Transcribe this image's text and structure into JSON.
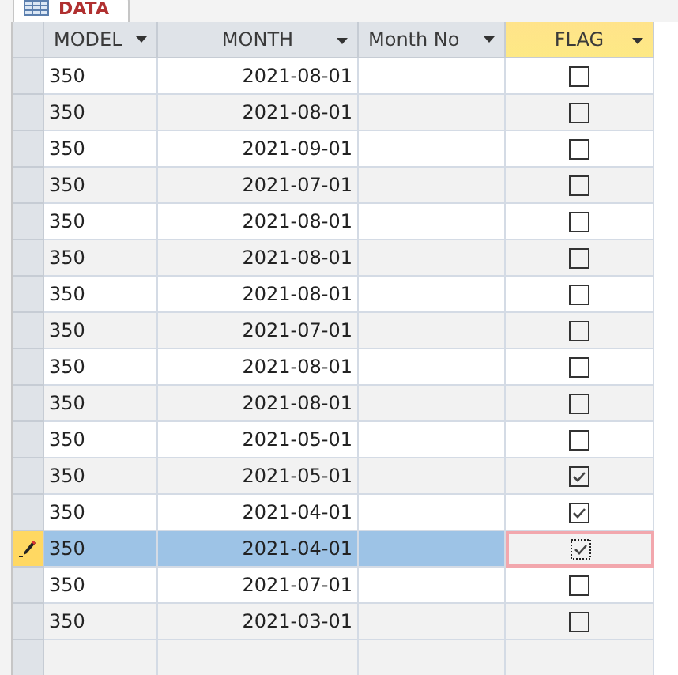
{
  "tab": {
    "label": "DATA"
  },
  "columns": [
    {
      "label": "MODEL",
      "selected": false
    },
    {
      "label": "MONTH",
      "selected": false
    },
    {
      "label": "Month No",
      "selected": false
    },
    {
      "label": "FLAG",
      "selected": true
    }
  ],
  "rows": [
    {
      "model": "350",
      "month": "2021-08-01",
      "checked": false,
      "selected": false
    },
    {
      "model": "350",
      "month": "2021-08-01",
      "checked": false,
      "selected": false
    },
    {
      "model": "350",
      "month": "2021-09-01",
      "checked": false,
      "selected": false
    },
    {
      "model": "350",
      "month": "2021-07-01",
      "checked": false,
      "selected": false
    },
    {
      "model": "350",
      "month": "2021-08-01",
      "checked": false,
      "selected": false
    },
    {
      "model": "350",
      "month": "2021-08-01",
      "checked": false,
      "selected": false
    },
    {
      "model": "350",
      "month": "2021-08-01",
      "checked": false,
      "selected": false
    },
    {
      "model": "350",
      "month": "2021-07-01",
      "checked": false,
      "selected": false
    },
    {
      "model": "350",
      "month": "2021-08-01",
      "checked": false,
      "selected": false
    },
    {
      "model": "350",
      "month": "2021-08-01",
      "checked": false,
      "selected": false
    },
    {
      "model": "350",
      "month": "2021-05-01",
      "checked": false,
      "selected": false
    },
    {
      "model": "350",
      "month": "2021-05-01",
      "checked": true,
      "selected": false
    },
    {
      "model": "350",
      "month": "2021-04-01",
      "checked": true,
      "selected": false
    },
    {
      "model": "350",
      "month": "2021-04-01",
      "checked": true,
      "selected": true
    },
    {
      "model": "350",
      "month": "2021-07-01",
      "checked": false,
      "selected": false
    },
    {
      "model": "350",
      "month": "2021-03-01",
      "checked": false,
      "selected": false
    }
  ]
}
